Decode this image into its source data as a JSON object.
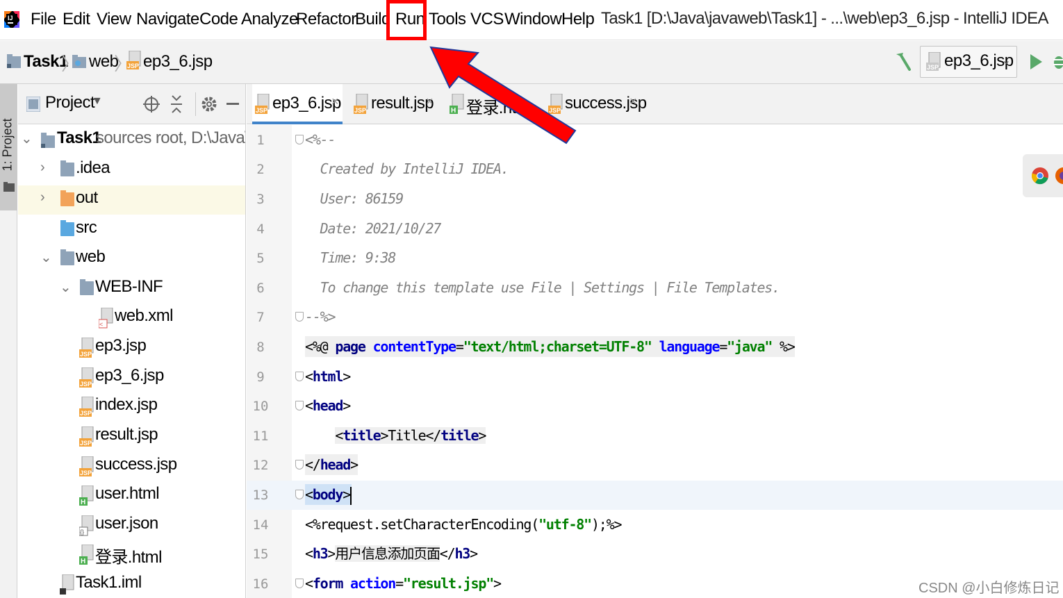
{
  "menu": {
    "items": [
      "File",
      "Edit",
      "View",
      "Navigate",
      "Code",
      "Analyze",
      "Refactor",
      "Build",
      "Run",
      "Tools",
      "VCS",
      "Window",
      "Help"
    ],
    "highlighted": "Run"
  },
  "window_title": "Task1 [D:\\Java\\javaweb\\Task1] - ...\\web\\ep3_6.jsp - IntelliJ IDEA",
  "breadcrumb": {
    "project": "Task1",
    "folder": "web",
    "file": "ep3_6.jsp"
  },
  "run_config": {
    "label": "ep3_6.jsp"
  },
  "left_stripe": {
    "tab_label": "1: Project"
  },
  "project_panel": {
    "title": "Project",
    "tree": [
      {
        "label": "Task1",
        "sub": "sources root,  D:\\Java\\javav",
        "icon": "module-folder-icon",
        "expanded": true
      },
      {
        "label": ".idea",
        "icon": "folder-icon",
        "expanded": false
      },
      {
        "label": "out",
        "icon": "folder-orange-icon",
        "expanded": false
      },
      {
        "label": "src",
        "icon": "folder-blue-icon"
      },
      {
        "label": "web",
        "icon": "web-folder-icon",
        "expanded": true
      },
      {
        "label": "WEB-INF",
        "icon": "folder-icon",
        "expanded": true
      },
      {
        "label": "web.xml",
        "icon": "xml-file-icon"
      },
      {
        "label": "ep3.jsp",
        "icon": "jsp-file-icon"
      },
      {
        "label": "ep3_6.jsp",
        "icon": "jsp-file-icon"
      },
      {
        "label": "index.jsp",
        "icon": "jsp-file-icon"
      },
      {
        "label": "result.jsp",
        "icon": "jsp-file-icon"
      },
      {
        "label": "success.jsp",
        "icon": "jsp-file-icon"
      },
      {
        "label": "user.html",
        "icon": "html-file-icon"
      },
      {
        "label": "user.json",
        "icon": "json-file-icon"
      },
      {
        "label": "登录.html",
        "icon": "html-file-icon"
      },
      {
        "label": "Task1.iml",
        "icon": "iml-file-icon"
      }
    ]
  },
  "editor_tabs": [
    {
      "label": "ep3_6.jsp",
      "active": true
    },
    {
      "label": "result.jsp",
      "active": false
    },
    {
      "label": "登录.htm",
      "active": false
    },
    {
      "label": "success.jsp",
      "active": false
    }
  ],
  "editor": {
    "line_numbers": [
      "1",
      "2",
      "3",
      "4",
      "5",
      "6",
      "7",
      "8",
      "9",
      "10",
      "11",
      "12",
      "13",
      "14",
      "15",
      "16"
    ],
    "lines": {
      "l1": "<%--",
      "l2": "  Created by IntelliJ IDEA.",
      "l3": "  User: 86159",
      "l4": "  Date: 2021/10/27",
      "l5": "  Time: 9:38",
      "l6": "  To change this template use File | Settings | File Templates.",
      "l7": "--%>",
      "l8_open": "<%@ ",
      "l8_page": "page ",
      "l8_ct_attr": "contentType",
      "l8_eq1": "=",
      "l8_ct_val": "\"text/html;charset=UTF-8\"",
      "l8_lang_attr": " language",
      "l8_eq2": "=",
      "l8_lang_val": "\"java\"",
      "l8_close": " %>",
      "l9_open": "<",
      "l9_tag": "html",
      "l9_close": ">",
      "l10_open": "<",
      "l10_tag": "head",
      "l10_close": ">",
      "l11_indent": "    ",
      "l11_o1": "<",
      "l11_tag1": "title",
      "l11_c1": ">",
      "l11_text": "Title",
      "l11_o2": "</",
      "l11_tag2": "title",
      "l11_c2": ">",
      "l12_open": "</",
      "l12_tag": "head",
      "l12_close": ">",
      "l13_open": "<",
      "l13_tag": "body",
      "l13_close": ">",
      "l14_open": "<%",
      "l14_code": "request.setCharacterEncoding(",
      "l14_str": "\"utf-8\"",
      "l14_end": ");",
      "l14_close": "%>",
      "l15_open": "<",
      "l15_tag1": "h3",
      "l15_c1": ">",
      "l15_text": "用户信息添加页面",
      "l15_o2": "</",
      "l15_tag2": "h3",
      "l15_c2": ">",
      "l16_open": "<",
      "l16_tag": "form",
      "l16_attr": " action",
      "l16_eq": "=",
      "l16_val": "\"result.jsp\"",
      "l16_close": ">"
    }
  },
  "watermark": "CSDN @小白修炼日记",
  "colors": {
    "highlight_box": "#ff0000",
    "arrow": "#ff0000",
    "active_tab_underline": "#4083c9"
  }
}
